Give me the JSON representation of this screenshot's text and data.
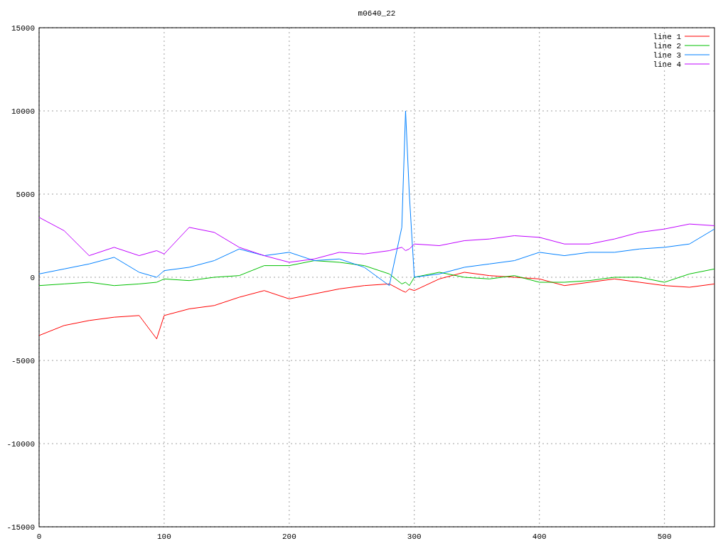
{
  "chart_data": {
    "type": "line",
    "title": "m0640_22",
    "x": [
      0,
      20,
      40,
      60,
      80,
      94,
      100,
      120,
      140,
      160,
      180,
      200,
      220,
      240,
      260,
      280,
      290,
      293,
      296,
      300,
      320,
      340,
      360,
      380,
      400,
      420,
      440,
      460,
      480,
      500,
      520,
      540
    ],
    "series": [
      {
        "name": "line 1",
        "color": "#ff0000",
        "values": [
          -3500,
          -2900,
          -2600,
          -2400,
          -2300,
          -3700,
          -2300,
          -1900,
          -1700,
          -1200,
          -800,
          -1300,
          -1000,
          -700,
          -500,
          -400,
          -800,
          -900,
          -700,
          -800,
          -100,
          300,
          100,
          0,
          -100,
          -500,
          -300,
          -100,
          -300,
          -500,
          -600,
          -400
        ]
      },
      {
        "name": "line 2",
        "color": "#00c000",
        "values": [
          -500,
          -400,
          -300,
          -500,
          -400,
          -300,
          -100,
          -200,
          0,
          100,
          700,
          700,
          1000,
          900,
          700,
          200,
          -400,
          -300,
          -500,
          0,
          300,
          0,
          -100,
          100,
          -300,
          -300,
          -200,
          0,
          0,
          -300,
          200,
          500
        ]
      },
      {
        "name": "line 3",
        "color": "#0080ff",
        "values": [
          200,
          500,
          800,
          1200,
          300,
          0,
          400,
          600,
          1000,
          1700,
          1300,
          1500,
          1000,
          1100,
          600,
          -500,
          3000,
          10000,
          5000,
          0,
          200,
          600,
          800,
          1000,
          1500,
          1300,
          1500,
          1500,
          1700,
          1800,
          2000,
          2900
        ]
      },
      {
        "name": "line 4",
        "color": "#c000ff",
        "values": [
          3600,
          2800,
          1300,
          1800,
          1300,
          1600,
          1400,
          3000,
          2700,
          1800,
          1300,
          900,
          1100,
          1500,
          1400,
          1600,
          1800,
          1600,
          1700,
          2000,
          1900,
          2200,
          2300,
          2500,
          2400,
          2000,
          2000,
          2300,
          2700,
          2900,
          3200,
          3100
        ]
      }
    ],
    "xlim": [
      0,
      540
    ],
    "ylim": [
      -15000,
      15000
    ],
    "xticks": [
      0,
      100,
      200,
      300,
      400,
      500
    ],
    "yticks": [
      -15000,
      -10000,
      -5000,
      0,
      5000,
      10000,
      15000
    ],
    "grid": true,
    "legend": true
  }
}
